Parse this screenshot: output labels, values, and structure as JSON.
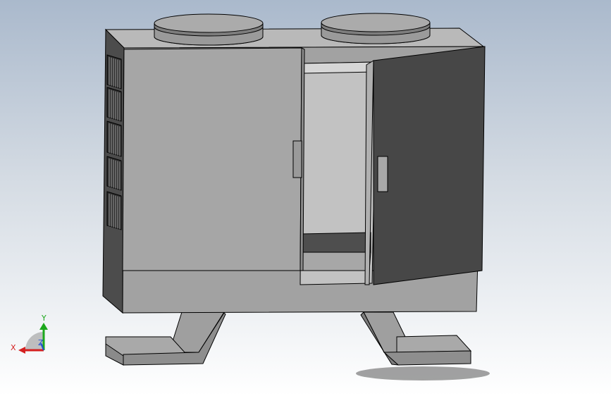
{
  "viewport": {
    "background_top": "#aab9cc",
    "background_bottom": "#ffffff"
  },
  "model": {
    "body_color": "#a6a6a6",
    "body_shade_color": "#8c8c8c",
    "side_color": "#4a4a4a",
    "open_door_color": "#464646",
    "interior_color": "#bdbdbd",
    "fan_top_color": "#a8a8a8",
    "fan_side_color": "#7a7a7a",
    "edge_color": "#000000"
  },
  "triad": {
    "x_label": "X",
    "y_label": "Y",
    "z_label": "Z",
    "x_color": "#d42020",
    "y_color": "#1ca81c",
    "z_color": "#2050d0"
  }
}
